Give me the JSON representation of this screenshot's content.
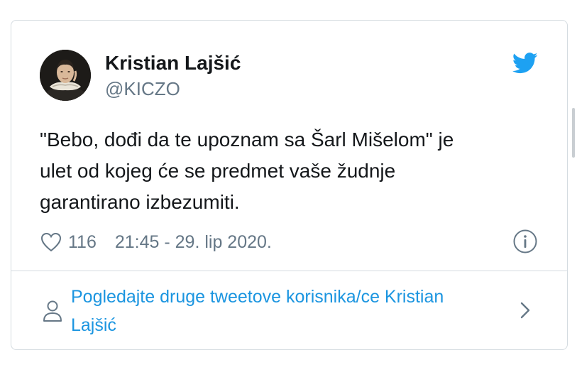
{
  "tweet": {
    "author_name": "Kristian Lajšić",
    "author_handle": "@KICZO",
    "text_lines": [
      "\"Bebo, dođi da te upoznam sa Šarl Mišelom\" je",
      "ulet od kojeg će se predmet vaše žudnje",
      "garantirano izbezumiti."
    ],
    "likes": "116",
    "timestamp": "21:45 - 29. lip 2020.",
    "icons": {
      "brand": "twitter-bird-icon",
      "like": "heart-icon",
      "info": "info-icon",
      "profile": "person-icon",
      "more": "chevron-right-icon"
    }
  },
  "footer": {
    "more_tweets_lines": [
      "Pogledajte druge tweetove korisnika/ce Kristian",
      "Lajšić"
    ]
  },
  "colors": {
    "accent": "#1da1f2",
    "link": "#1b95e0",
    "secondary_text": "#657786",
    "border": "#d4dbe0"
  }
}
